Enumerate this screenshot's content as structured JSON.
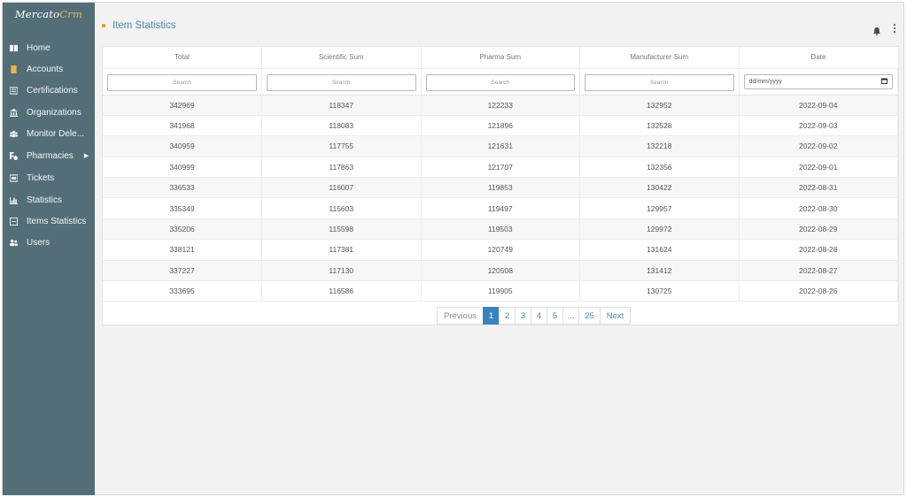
{
  "app": {
    "logo_main": "Mercato",
    "logo_accent": "Crm"
  },
  "sidebar": {
    "items": [
      {
        "label": "Home",
        "icon": "home-icon"
      },
      {
        "label": "Accounts",
        "icon": "accounts-icon"
      },
      {
        "label": "Certifications",
        "icon": "certifications-icon"
      },
      {
        "label": "Organizations",
        "icon": "organizations-icon"
      },
      {
        "label": "Monitor Dele...",
        "icon": "monitor-icon"
      },
      {
        "label": "Pharmacies",
        "icon": "pharmacies-icon",
        "caret": "▶"
      },
      {
        "label": "Tickets",
        "icon": "tickets-icon"
      },
      {
        "label": "Statistics",
        "icon": "statistics-icon"
      },
      {
        "label": "Items Statistics",
        "icon": "items-statistics-icon"
      },
      {
        "label": "Users",
        "icon": "users-icon"
      }
    ]
  },
  "header": {
    "title": "Item Statistics",
    "accent_color": "#e8a03b",
    "icons": [
      "bell-icon",
      "kebab-menu-icon"
    ]
  },
  "table": {
    "columns": [
      "Total",
      "Scientific Sum",
      "Pharma Sum",
      "Manufacturer Sum",
      "Date"
    ],
    "filter_placeholder": "Search",
    "date_placeholder": "dd/mm/yyyy",
    "rows": [
      [
        "342969",
        "118347",
        "122233",
        "132952",
        "2022-09-04"
      ],
      [
        "341968",
        "118083",
        "121896",
        "132528",
        "2022-09-03"
      ],
      [
        "340959",
        "117755",
        "121631",
        "132218",
        "2022-09-02"
      ],
      [
        "340999",
        "117863",
        "121707",
        "132356",
        "2022-09-01"
      ],
      [
        "336533",
        "116007",
        "119853",
        "130422",
        "2022-08-31"
      ],
      [
        "335349",
        "115603",
        "119497",
        "129957",
        "2022-08-30"
      ],
      [
        "335206",
        "115598",
        "119503",
        "129972",
        "2022-08-29"
      ],
      [
        "338121",
        "117381",
        "120749",
        "131624",
        "2022-08-28"
      ],
      [
        "337227",
        "117130",
        "120508",
        "131412",
        "2022-08-27"
      ],
      [
        "333695",
        "116586",
        "119905",
        "130725",
        "2022-08-26"
      ]
    ]
  },
  "pagination": {
    "previous": "Previous",
    "pages": [
      "1",
      "2",
      "3",
      "4",
      "5"
    ],
    "ellipsis": "...",
    "last": "25",
    "next": "Next",
    "active_page": "1",
    "active_color": "#3a84bd"
  },
  "colors": {
    "sidebar_bg": "#546e78",
    "link": "#4a8ab3"
  }
}
